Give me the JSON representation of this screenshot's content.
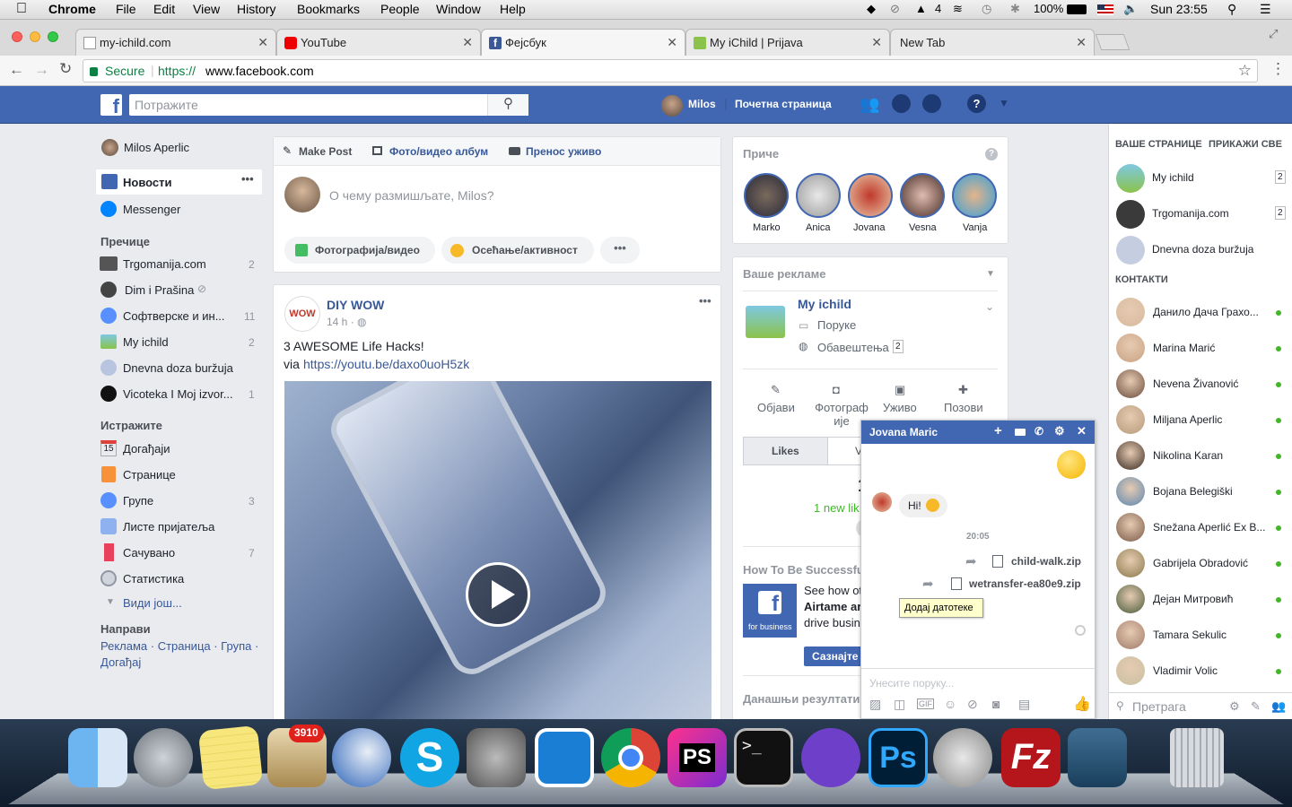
{
  "menubar": {
    "app": "Chrome",
    "items": [
      "File",
      "Edit",
      "View",
      "History",
      "Bookmarks",
      "People",
      "Window",
      "Help"
    ],
    "battery": "100%",
    "clock": "Sun 23:55",
    "aws_count": "4"
  },
  "tabs": [
    {
      "title": "my-ichild.com",
      "active": false
    },
    {
      "title": "YouTube",
      "active": false
    },
    {
      "title": "Фејсбук",
      "active": true
    },
    {
      "title": "My iChild | Prijava",
      "active": false
    },
    {
      "title": "New Tab",
      "active": false
    }
  ],
  "address": {
    "secure": "Secure",
    "scheme": "https://",
    "host": "www.facebook.com"
  },
  "fb": {
    "search_placeholder": "Потражите",
    "user": "Milos",
    "home": "Почетна страница"
  },
  "left": {
    "profile": "Milos Aperlic",
    "news": "Новости",
    "messenger": "Messenger",
    "shortcuts_title": "Пречице",
    "shortcuts": [
      {
        "label": "Trgomanija.com",
        "count": "2"
      },
      {
        "label": "Dim i Prašina",
        "count": ""
      },
      {
        "label": "Софтверске и ин...",
        "count": "11"
      },
      {
        "label": "My ichild",
        "count": "2"
      },
      {
        "label": "Dnevna doza buržuja",
        "count": ""
      },
      {
        "label": "Vicoteka I Moj izvor...",
        "count": "1"
      }
    ],
    "explore_title": "Истражите",
    "explore": [
      {
        "label": "Догађаји",
        "count": ""
      },
      {
        "label": "Странице",
        "count": ""
      },
      {
        "label": "Групе",
        "count": "3"
      },
      {
        "label": "Листе пријатеља",
        "count": ""
      },
      {
        "label": "Сачувано",
        "count": "7"
      },
      {
        "label": "Статистика",
        "count": ""
      }
    ],
    "see_more": "Види још...",
    "create_title": "Направи",
    "create_line1": "Реклама · Страница · Група ·",
    "create_line2": "Догађај",
    "calendar_day": "15"
  },
  "composer": {
    "tab_post": "Make Post",
    "tab_album": "Фото/видео албум",
    "tab_live": "Пренос уживо",
    "placeholder": "О чему размишљате, Milos?",
    "btn_photo": "Фотографија/видео",
    "btn_feeling": "Осећање/активност"
  },
  "post": {
    "page": "DIY WOW",
    "time": "14 h · ",
    "text": "3 AWESOME Life Hacks!",
    "via": "via ",
    "link": "https://youtu.be/daxo0uoH5zk",
    "logo": "WOW"
  },
  "stories": {
    "title": "Приче",
    "names": [
      "Marko",
      "Anica",
      "Jovana",
      "Vesna",
      "Vanja"
    ]
  },
  "ads": {
    "title": "Ваше рекламе",
    "page": "My ichild",
    "messages": "Поруке",
    "notifications": "Обавештења",
    "notif_count": "2",
    "actions": [
      "Објави",
      "Фотограф ије",
      "Уживо",
      "Позови"
    ],
    "likes_tab": "Likes",
    "v_tab": "V",
    "big_num": "1",
    "new_likes": "1 new lik",
    "howto_title": "How To Be Successfu",
    "howto_text1": "See how ot",
    "howto_text2": "Airtame ar",
    "howto_text3": "drive busin",
    "fb_business": "for business",
    "learn_btn": "Сазнајте",
    "today": "Данашњи резултати"
  },
  "right": {
    "pages_title": "ВАШЕ СТРАНИЦЕ",
    "show_all": "ПРИКАЖИ СВЕ",
    "pages": [
      {
        "label": "My ichild",
        "count": "2"
      },
      {
        "label": "Trgomanija.com",
        "count": "2"
      },
      {
        "label": "Dnevna doza buržuja",
        "count": ""
      }
    ],
    "contacts_title": "КОНТАКТИ",
    "contacts": [
      "Данило Дача Грахо...",
      "Marina Marić",
      "Nevena Živanović",
      "Miljana Aperlic",
      "Nikolina Karan",
      "Bojana Belegiški",
      "Snežana Aperlić Ex B...",
      "Gabrijela Obradović",
      "Дејан Митровић",
      "Tamara Sekulic",
      "Vladimir Volic"
    ],
    "search": "Претрага"
  },
  "chat": {
    "name": "Jovana Maric",
    "msg": "Hi!",
    "time": "20:05",
    "file1": "child-walk.zip",
    "file2": "wetransfer-ea80e9.zip",
    "tooltip": "Додај датотеке",
    "placeholder": "Унесите поруку..."
  },
  "dock": {
    "mail_badge": "3910"
  },
  "colors": {
    "fb_blue": "#4267b2",
    "link": "#385898",
    "online": "#42b72a"
  }
}
